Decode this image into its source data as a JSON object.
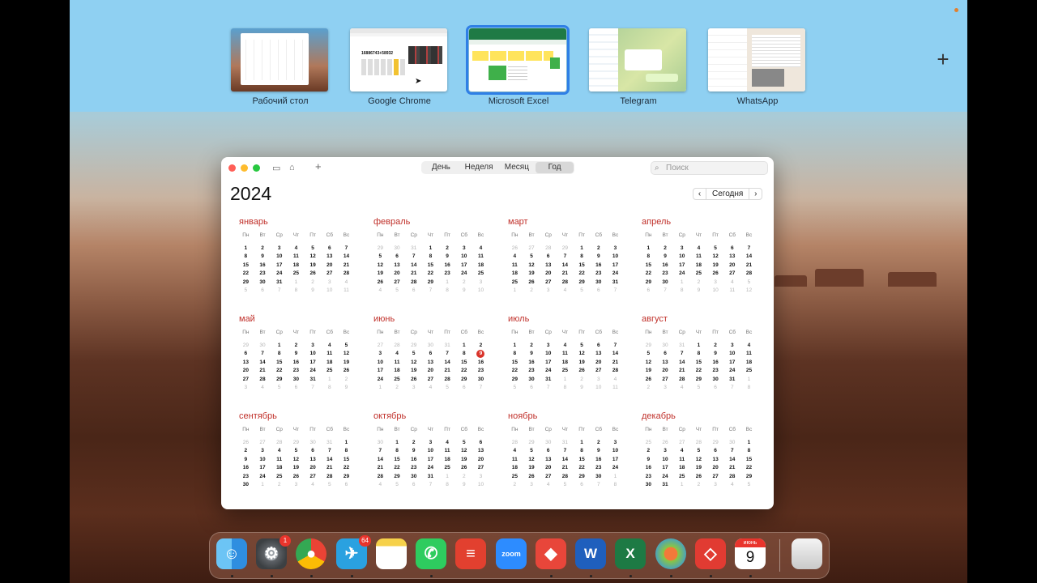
{
  "spaces": [
    {
      "label": "Рабочий стол",
      "active": false
    },
    {
      "label": "Google Chrome",
      "active": false,
      "thumb_text": "16886743+58932"
    },
    {
      "label": "Microsoft Excel",
      "active": true
    },
    {
      "label": "Telegram",
      "active": false
    },
    {
      "label": "WhatsApp",
      "active": false
    }
  ],
  "add_space": "+",
  "calendar": {
    "views": [
      "День",
      "Неделя",
      "Месяц",
      "Год"
    ],
    "selected_view": "Год",
    "search_placeholder": "Поиск",
    "year": "2024",
    "today_button": "Сегодня",
    "prev": "‹",
    "next": "›",
    "weekdays": [
      "Пн",
      "Вт",
      "Ср",
      "Чт",
      "Пт",
      "Сб",
      "Вс"
    ],
    "months": [
      "январь",
      "февраль",
      "март",
      "апрель",
      "май",
      "июнь",
      "июль",
      "август",
      "сентябрь",
      "октябрь",
      "ноябрь",
      "декабрь"
    ],
    "today": {
      "month": 6,
      "day": 9
    }
  },
  "dock": {
    "apps": [
      {
        "name": "Finder"
      },
      {
        "name": "System Settings",
        "badge": "1"
      },
      {
        "name": "Google Chrome"
      },
      {
        "name": "Telegram",
        "badge": "64"
      },
      {
        "name": "Notes"
      },
      {
        "name": "WhatsApp"
      },
      {
        "name": "Todoist"
      },
      {
        "name": "Zoom",
        "label": "zoom"
      },
      {
        "name": "AnyDesk"
      },
      {
        "name": "Microsoft Word",
        "label": "W"
      },
      {
        "name": "Microsoft Excel",
        "label": "X"
      },
      {
        "name": "Vivaldi"
      },
      {
        "name": "AnyDesk Red"
      },
      {
        "name": "Calendar",
        "month_label": "июнь",
        "day_label": "9"
      },
      {
        "name": "Trash"
      }
    ]
  }
}
